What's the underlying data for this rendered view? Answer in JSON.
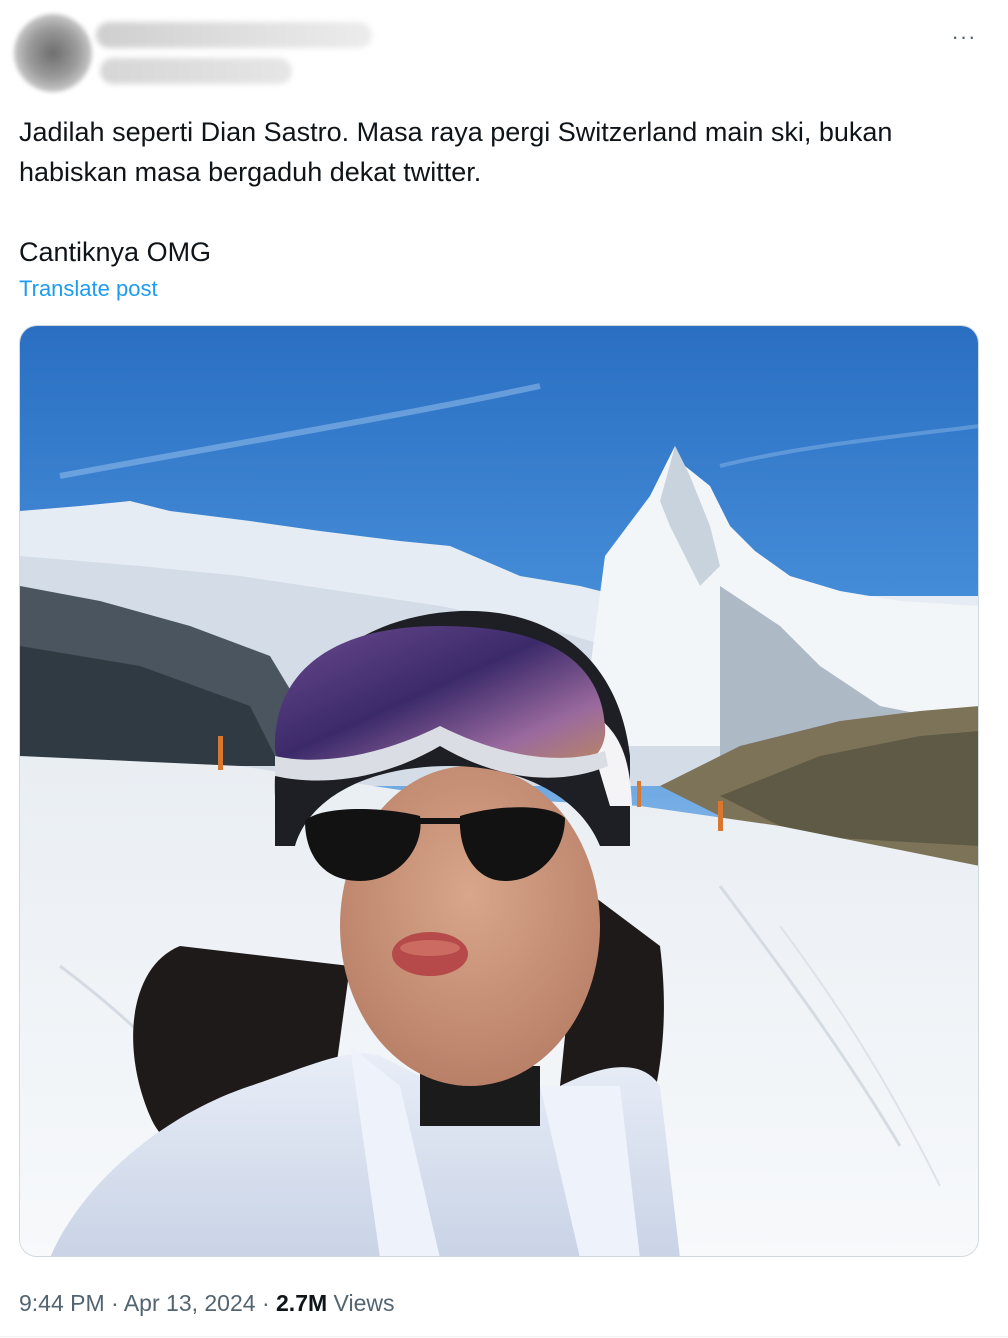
{
  "post": {
    "more_icon": "···",
    "text_line1": "Jadilah seperti Dian Sastro. Masa raya pergi Switzerland main ski, bukan habiskan masa bergaduh dekat twitter.",
    "text_line2": "Cantiknya OMG",
    "translate_label": "Translate post",
    "media": {
      "icon": "photo",
      "description_colors": {
        "sky": "#2f7fd0",
        "snow": "#f1f4f7",
        "jacket": "#dfe6f3"
      }
    },
    "time": "9:44 PM",
    "separator": "·",
    "date": "Apr 13, 2024",
    "views_count": "2.7M",
    "views_label": "Views"
  },
  "colors": {
    "link": "#1d9bf0",
    "text": "#0f1419",
    "secondary": "#536471",
    "border": "#cfd9de"
  }
}
